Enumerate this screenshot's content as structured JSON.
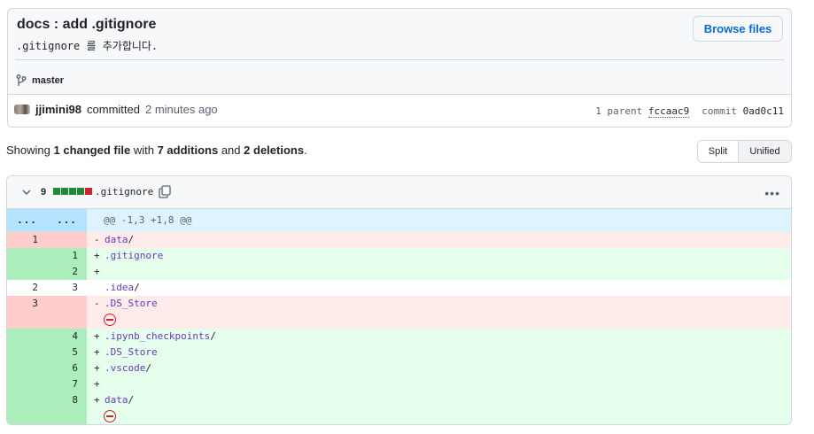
{
  "commit": {
    "title": "docs : add .gitignore",
    "description": ".gitignore 를 추가합니다.",
    "browse_files_label": "Browse files",
    "branch": "master",
    "author": "jjimini98",
    "action": "committed",
    "time": "2 minutes ago",
    "parent_label": "1 parent",
    "parent_sha": "fccaac9",
    "commit_label": "commit",
    "commit_sha": "0ad0c11"
  },
  "summary": {
    "prefix": "Showing",
    "changed": "1 changed file",
    "with": "with",
    "additions": "7 additions",
    "and": "and",
    "deletions": "2 deletions",
    "suffix": "."
  },
  "view_toggle": {
    "split": "Split",
    "unified": "Unified",
    "selected": "Unified"
  },
  "file": {
    "changes": "9",
    "name": ".gitignore",
    "diffstat": [
      "add",
      "add",
      "add",
      "add",
      "del"
    ],
    "hunk_expand_left": "...",
    "hunk_expand_right": "...",
    "hunk_header": "@@ -1,3 +1,8 @@",
    "lines": [
      {
        "type": "del",
        "old": "1",
        "new": "",
        "sign": "-",
        "text": "data",
        "slash": "/"
      },
      {
        "type": "add",
        "old": "",
        "new": "1",
        "sign": "+",
        "text": ".gitignore",
        "slash": ""
      },
      {
        "type": "add",
        "old": "",
        "new": "2",
        "sign": "+",
        "text": "",
        "slash": ""
      },
      {
        "type": "ctx",
        "old": "2",
        "new": "3",
        "sign": " ",
        "text": ".idea",
        "slash": "/"
      },
      {
        "type": "del",
        "old": "3",
        "new": "",
        "sign": "-",
        "text": ".DS_Store",
        "slash": ""
      },
      {
        "type": "add",
        "old": "",
        "new": "4",
        "sign": "+",
        "text": ".ipynb_checkpoints",
        "slash": "/"
      },
      {
        "type": "add",
        "old": "",
        "new": "5",
        "sign": "+",
        "text": ".DS_Store",
        "slash": ""
      },
      {
        "type": "add",
        "old": "",
        "new": "6",
        "sign": "+",
        "text": ".vscode",
        "slash": "/"
      },
      {
        "type": "add",
        "old": "",
        "new": "7",
        "sign": "+",
        "text": "",
        "slash": ""
      },
      {
        "type": "add",
        "old": "",
        "new": "8",
        "sign": "+",
        "text": "data",
        "slash": "/"
      }
    ]
  },
  "colors": {
    "accent": "#0969da",
    "addition": "#1f883d",
    "deletion": "#cf222e"
  }
}
